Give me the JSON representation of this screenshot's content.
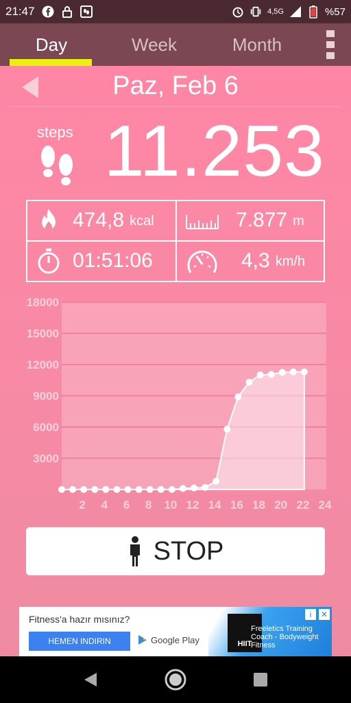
{
  "status_bar": {
    "time": "21:47",
    "network": "4,5G",
    "battery": "%57"
  },
  "tabs": [
    {
      "label": "Day",
      "active": true
    },
    {
      "label": "Week",
      "active": false
    },
    {
      "label": "Month",
      "active": false
    }
  ],
  "date_title": "Paz, Feb 6",
  "steps": {
    "label": "steps",
    "value": "11.253"
  },
  "stats": {
    "calories": {
      "value": "474,8",
      "unit": "kcal",
      "icon": "flame-icon"
    },
    "distance": {
      "value": "7.877",
      "unit": "m",
      "icon": "ruler-icon"
    },
    "duration": {
      "value": "01:51:06",
      "icon": "stopwatch-icon"
    },
    "speed": {
      "value": "4,3",
      "unit": "km/h",
      "icon": "speedometer-icon"
    }
  },
  "chart_data": {
    "type": "area",
    "x": [
      0,
      1,
      2,
      3,
      4,
      5,
      6,
      7,
      8,
      9,
      10,
      11,
      12,
      13,
      14,
      15,
      16,
      17,
      18,
      19,
      20,
      21,
      22
    ],
    "values": [
      0,
      0,
      0,
      0,
      0,
      0,
      0,
      0,
      0,
      0,
      0,
      100,
      150,
      200,
      800,
      5800,
      8900,
      10300,
      11000,
      11050,
      11250,
      11300,
      11300
    ],
    "ylim": [
      0,
      18000
    ],
    "yticks": [
      3000,
      6000,
      9000,
      12000,
      15000,
      18000
    ],
    "xlim": [
      0,
      24
    ],
    "xticks": [
      2,
      4,
      6,
      8,
      10,
      12,
      14,
      16,
      18,
      20,
      22,
      24
    ],
    "grid": true
  },
  "stop_button": {
    "label": "STOP"
  },
  "ad": {
    "title": "Fitness'a hazır mısınız?",
    "cta": "HEMEN INDIRIN",
    "store": "Google Play",
    "logo_text": "HIIT",
    "description": "Freeletics Training Coach - Bodyweight Fitness"
  }
}
